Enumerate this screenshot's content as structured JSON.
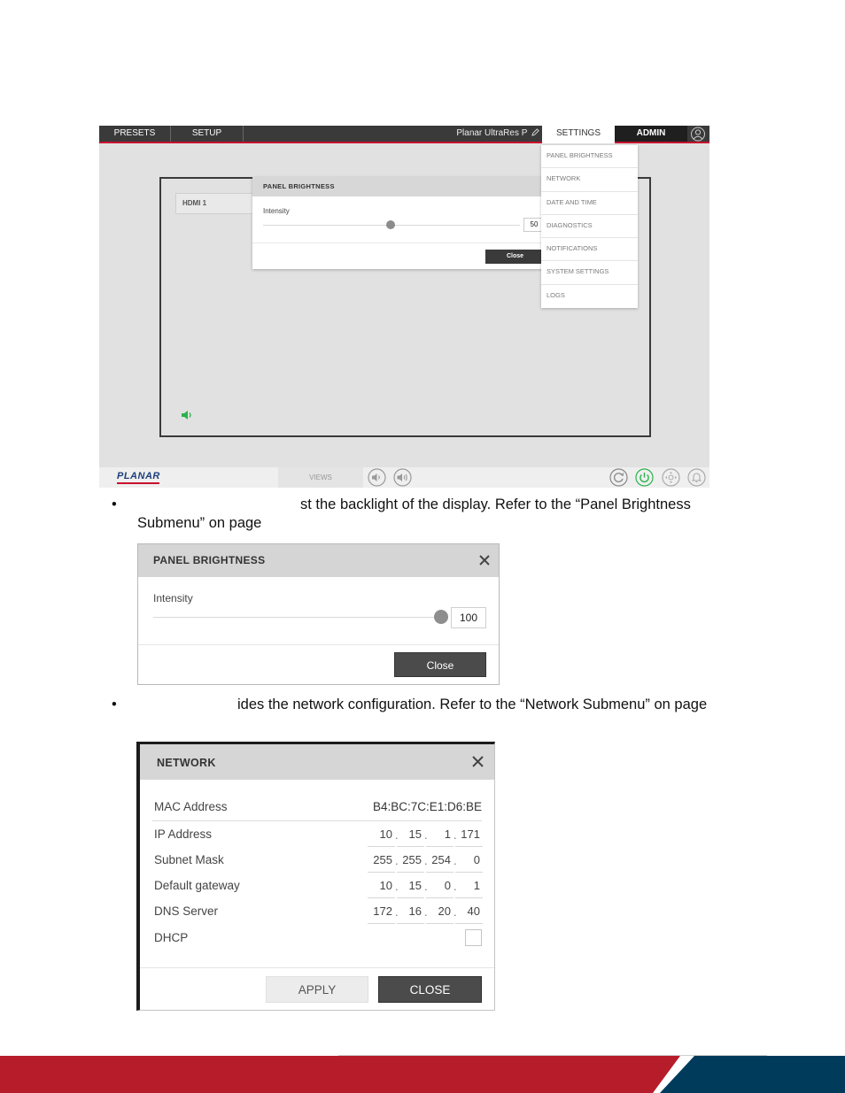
{
  "screenshot1": {
    "topbar": {
      "presets": "PRESETS",
      "setup": "SETUP",
      "device_name": "Planar UltraRes P",
      "settings": "SETTINGS",
      "admin": "ADMIN"
    },
    "input_tile": "HDMI 1",
    "panel_dialog": {
      "title": "PANEL BRIGHTNESS",
      "label": "Intensity",
      "value": "50",
      "slider_fraction": 0.5,
      "close": "Close"
    },
    "settings_menu": [
      "PANEL BRIGHTNESS",
      "NETWORK",
      "DATE AND TIME",
      "DIAGNOSTICS",
      "NOTIFICATIONS",
      "SYSTEM SETTINGS",
      "LOGS"
    ],
    "bottombar": {
      "logo": "PLANAR",
      "views": "VIEWS"
    }
  },
  "bullet1": {
    "bullet": "•",
    "line1": "st the backlight of the display. Refer to the “Panel Brightness",
    "line2": "Submenu” on page"
  },
  "panel_brightness": {
    "title": "PANEL BRIGHTNESS",
    "label": "Intensity",
    "value": "100",
    "slider_fraction": 1.0,
    "close": "Close"
  },
  "bullet2": {
    "bullet": "•",
    "line1": "ides the network configuration. Refer to the “Network Submenu” on page"
  },
  "network": {
    "title": "NETWORK",
    "mac_label": "MAC Address",
    "mac_value": "B4:BC:7C:E1:D6:BE",
    "rows": [
      {
        "label": "IP Address",
        "octets": [
          "10",
          "15",
          "1",
          "171"
        ]
      },
      {
        "label": "Subnet Mask",
        "octets": [
          "255",
          "255",
          "254",
          "0"
        ]
      },
      {
        "label": "Default gateway",
        "octets": [
          "10",
          "15",
          "0",
          "1"
        ]
      },
      {
        "label": "DNS Server",
        "octets": [
          "172",
          "16",
          "20",
          "40"
        ]
      }
    ],
    "dhcp_label": "DHCP",
    "dhcp_checked": false,
    "apply": "APPLY",
    "close": "CLOSE"
  },
  "colors": {
    "brand_red": "#b71c2a",
    "brand_navy": "#003b5c",
    "topbar_dark": "#3a3a3a",
    "power_green": "#2bb24c"
  }
}
